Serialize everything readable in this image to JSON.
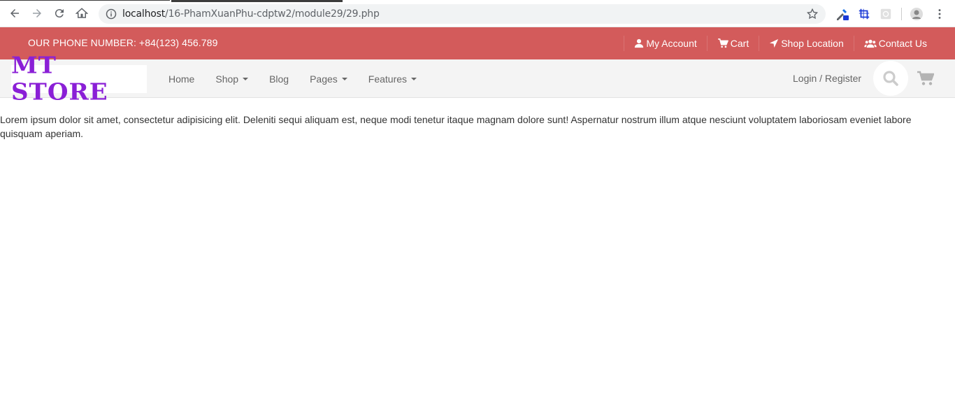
{
  "browser": {
    "url_host": "localhost",
    "url_path": "/16-PhamXuanPhu-cdptw2/module29/29.php"
  },
  "topbar": {
    "phone": "OUR PHONE NUMBER: +84(123) 456.789",
    "links": [
      {
        "label": "My Account",
        "icon": "user-icon"
      },
      {
        "label": "Cart",
        "icon": "cart-icon"
      },
      {
        "label": "Shop Location",
        "icon": "location-arrow-icon"
      },
      {
        "label": "Contact Us",
        "icon": "users-icon"
      }
    ],
    "bg_color": "#d35b5b"
  },
  "navbar": {
    "logo_text": "MT STORE",
    "logo_color": "#8a1fd6",
    "menu": [
      {
        "label": "Home",
        "dropdown": false
      },
      {
        "label": "Shop",
        "dropdown": true
      },
      {
        "label": "Blog",
        "dropdown": false
      },
      {
        "label": "Pages",
        "dropdown": true
      },
      {
        "label": "Features",
        "dropdown": true
      }
    ],
    "login_label": "Login / Register"
  },
  "content": {
    "text": "Lorem ipsum dolor sit amet, consectetur adipisicing elit. Deleniti sequi aliquam est, neque modi tenetur itaque magnam dolore sunt! Aspernatur nostrum illum atque nesciunt voluptatem laboriosam eveniet labore quisquam aperiam."
  }
}
